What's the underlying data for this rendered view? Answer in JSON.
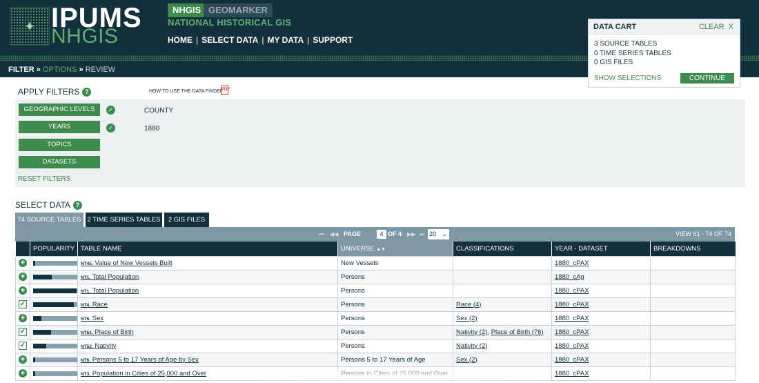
{
  "brand": {
    "logo_main": "IPUMS",
    "logo_sub": "NHGIS",
    "tab_active": "NHGIS",
    "tab_other": "GEOMARKER",
    "subtitle": "NATIONAL HISTORICAL GIS"
  },
  "topnav": [
    "HOME",
    "SELECT DATA",
    "MY DATA",
    "SUPPORT"
  ],
  "crumbs": {
    "filter": "FILTER",
    "options": "OPTIONS",
    "review": "REVIEW",
    "sep": "»"
  },
  "cart": {
    "title": "DATA CART",
    "clear": "CLEAR",
    "close": "X",
    "lines": [
      "3 SOURCE TABLES",
      "0 TIME SERIES TABLES",
      "0 GIS FILES"
    ],
    "show": "SHOW SELECTIONS",
    "continue": "CONTINUE"
  },
  "filters": {
    "heading": "APPLY FILTERS",
    "help": "?",
    "how_link": "HOW TO USE THE DATA FINDER",
    "buttons": [
      "GEOGRAPHIC LEVELS",
      "YEARS",
      "TOPICS",
      "DATASETS"
    ],
    "values": [
      "COUNTY",
      "1880"
    ],
    "reset": "RESET FILTERS"
  },
  "select": {
    "heading": "SELECT DATA",
    "tabs": [
      "74 SOURCE TABLES",
      "2 TIME SERIES TABLES",
      "2 GIS FILES"
    ]
  },
  "pager": {
    "page_label": "PAGE",
    "page": "4",
    "of": "OF 4",
    "page_size": "20",
    "view": "VIEW 61 - 74 OF 74"
  },
  "table": {
    "headers": [
      "",
      "POPULARITY",
      "TABLE NAME",
      "UNIVERSE",
      "CLASSIFICATIONS",
      "YEAR - DATASET",
      "BREAKDOWNS"
    ],
    "rows": [
      {
        "action": "add",
        "popularity": 0.04,
        "code": "NT45.",
        "name": "Value of New Vessels Built",
        "universe": "New Vessels",
        "class": [],
        "dataset": "1880_cPAX"
      },
      {
        "action": "add",
        "popularity": 0.42,
        "code": "NT1.",
        "name": "Total Population",
        "universe": "Persons",
        "class": [],
        "dataset": "1880_cAg"
      },
      {
        "action": "add",
        "popularity": 0.97,
        "code": "NT1.",
        "name": "Total Population",
        "universe": "Persons",
        "class": [],
        "dataset": "1880_cPAX"
      },
      {
        "action": "checked",
        "popularity": 0.9,
        "code": "NT4.",
        "name": "Race",
        "universe": "Persons",
        "class": [
          "Race (4)"
        ],
        "dataset": "1880_cPAX"
      },
      {
        "action": "add",
        "popularity": 0.19,
        "code": "NT5.",
        "name": "Sex",
        "universe": "Persons",
        "class": [
          "Sex (2)"
        ],
        "dataset": "1880_cPAX"
      },
      {
        "action": "checked",
        "popularity": 0.4,
        "code": "NT51.",
        "name": "Place of Birth",
        "universe": "Persons",
        "class": [
          "Nativity (2)",
          "Place of Birth (76)"
        ],
        "dataset": "1880_cPAX"
      },
      {
        "action": "checked",
        "popularity": 0.29,
        "code": "NT52.",
        "name": "Nativity",
        "universe": "Persons",
        "class": [
          "Nativity (2)"
        ],
        "dataset": "1880_cPAX"
      },
      {
        "action": "add",
        "popularity": 0.05,
        "code": "NT6.",
        "name": "Persons 5 to 17 Years of Age by Sex",
        "universe": "Persons 5 to 17 Years of Age",
        "class": [
          "Sex (2)"
        ],
        "dataset": "1880_cPAX"
      },
      {
        "action": "add",
        "popularity": 0.05,
        "code": "NT3.",
        "name": "Population in Cities of 25,000 and Over",
        "universe": "Persons in Cities of 25,000 and Over",
        "class": [],
        "dataset": "1880_cPAX"
      }
    ]
  }
}
